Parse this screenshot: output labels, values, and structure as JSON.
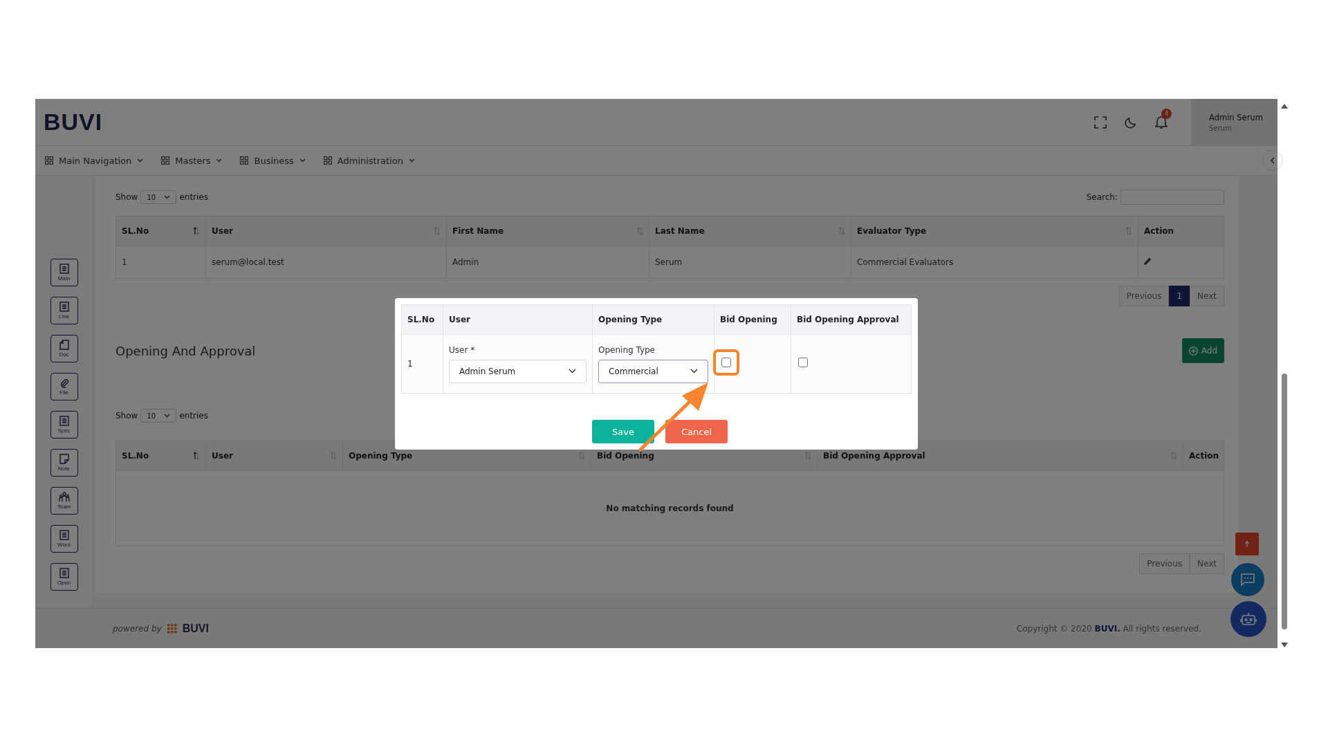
{
  "header": {
    "logo": "BUVI",
    "notification_count": "4",
    "user": {
      "name": "Admin Serum",
      "role": "Serum"
    }
  },
  "nav": {
    "items": [
      "Main Navigation",
      "Masters",
      "Business",
      "Administration"
    ]
  },
  "sidebar": {
    "items": [
      {
        "label": "Main",
        "kind": "list"
      },
      {
        "label": "Line",
        "kind": "list"
      },
      {
        "label": "Doc",
        "kind": "page"
      },
      {
        "label": "File",
        "kind": "clip"
      },
      {
        "label": "Spec",
        "kind": "list"
      },
      {
        "label": "Note",
        "kind": "note"
      },
      {
        "label": "Team",
        "kind": "team"
      },
      {
        "label": "Word",
        "kind": "list"
      },
      {
        "label": "Open",
        "kind": "list"
      }
    ]
  },
  "evaluators": {
    "show_label": "Show",
    "page_size": "10",
    "entries_label": "entries",
    "search_label": "Search:",
    "columns": [
      {
        "label": "SL.No",
        "sortable": true,
        "sorted": true
      },
      {
        "label": "User",
        "sortable": true,
        "sorted": false
      },
      {
        "label": "First Name",
        "sortable": true,
        "sorted": false
      },
      {
        "label": "Last Name",
        "sortable": true,
        "sorted": false
      },
      {
        "label": "Evaluator Type",
        "sortable": true,
        "sorted": false
      },
      {
        "label": "Action",
        "sortable": false
      }
    ],
    "rows": [
      {
        "cells": [
          "1",
          "serum@local.test",
          "Admin",
          "Serum",
          "Commercial Evaluators"
        ],
        "editable": true
      }
    ],
    "pagination": {
      "previous": "Previous",
      "pages": [
        {
          "label": "1",
          "selected": true
        }
      ],
      "next": "Next"
    }
  },
  "opening": {
    "title": "Opening And Approval",
    "add_button": "Add",
    "show_label": "Show",
    "page_size": "10",
    "entries_label": "entries",
    "columns": [
      {
        "label": "SL.No",
        "sortable": true,
        "sorted": true
      },
      {
        "label": "User",
        "sortable": true,
        "sorted": false
      },
      {
        "label": "Opening Type",
        "sortable": true,
        "sorted": false
      },
      {
        "label": "Bid Opening",
        "sortable": true,
        "sorted": false
      },
      {
        "label": "Bid Opening Approval",
        "sortable": true,
        "sorted": false
      },
      {
        "label": "Action",
        "sortable": false
      }
    ],
    "empty_message": "No matching records found",
    "pagination": {
      "previous": "Previous",
      "next": "Next"
    }
  },
  "footer": {
    "powered_by": "powered by",
    "brand": "BUVI",
    "copyright": "Copyright © 2020 **BUVI.** All rights reserved."
  },
  "modal": {
    "columns": [
      "SL.No",
      "User",
      "Opening Type",
      "Bid Opening",
      "Bid Opening Approval"
    ],
    "row": {
      "sl": "1",
      "user_label": "User *",
      "user_value": "Admin Serum",
      "opening_type_label": "Opening Type",
      "opening_type_value": "Commercial",
      "bid_opening": {
        "checked": false,
        "highlighted": true
      },
      "bid_opening_approval": {
        "checked": false
      }
    },
    "save": "Save",
    "cancel": "Cancel"
  }
}
